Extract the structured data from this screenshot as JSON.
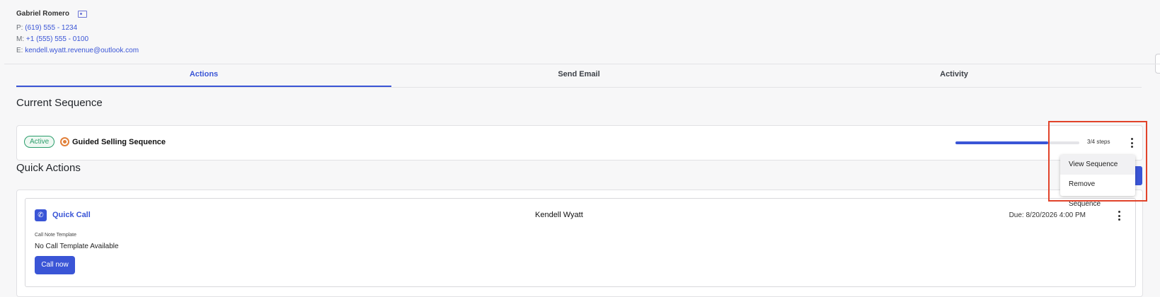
{
  "contact": {
    "name": "Gabriel Romero",
    "phone_label": "P:",
    "phone": "(619) 555 - 1234",
    "mobile_label": "M:",
    "mobile": "+1 (555) 555 - 0100",
    "email_label": "E:",
    "email": "kendell.wyatt.revenue@outlook.com"
  },
  "tabs": [
    {
      "label": "Actions",
      "active": true
    },
    {
      "label": "Send Email",
      "active": false
    },
    {
      "label": "Activity",
      "active": false
    }
  ],
  "current_sequence": {
    "section_title": "Current Sequence",
    "status": "Active",
    "name": "Guided Selling Sequence",
    "progress_fraction": 0.75,
    "steps_text": "3/4 steps",
    "menu": [
      "View Sequence",
      "Remove Sequence"
    ]
  },
  "quick_actions": {
    "section_title": "Quick Actions",
    "item": {
      "title": "Quick Call",
      "contact": "Kendell Wyatt",
      "due": "Due: 8/20/2026 4:00 PM",
      "template_label": "Call Note Template",
      "template_value": "No Call Template Available",
      "button_label": "Call now"
    }
  },
  "colors": {
    "accent": "#3a55d6",
    "active_badge": "#2a9d6b",
    "highlight": "#e1432a"
  }
}
